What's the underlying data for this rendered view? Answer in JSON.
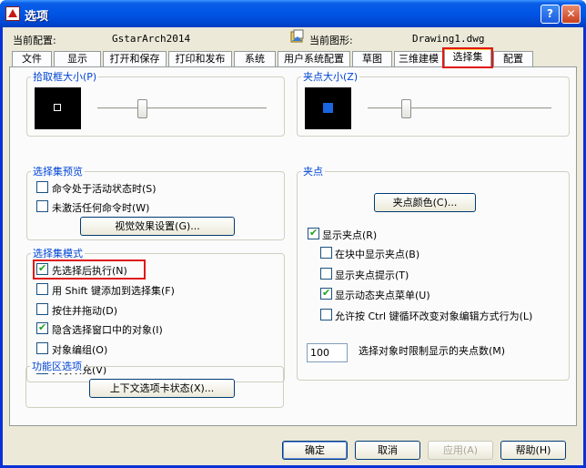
{
  "window": {
    "title": "选项"
  },
  "header": {
    "profile_label": "当前配置:",
    "profile_value": "GstarArch2014",
    "drawing_label": "当前图形:",
    "drawing_value": "Drawing1.dwg"
  },
  "tabs": [
    "文件",
    "显示",
    "打开和保存",
    "打印和发布",
    "系统",
    "用户系统配置",
    "草图",
    "三维建模",
    "选择集",
    "配置"
  ],
  "active_tab": "选择集",
  "pickbox": {
    "title": "拾取框大小(P)",
    "slider_level": 0.5
  },
  "grip_size": {
    "title": "夹点大小(Z)",
    "slider_level": 0.35
  },
  "selection_preview": {
    "title": "选择集预览",
    "options": [
      {
        "label": "命令处于活动状态时(S)",
        "checked": false
      },
      {
        "label": "未激活任何命令时(W)",
        "checked": false
      }
    ],
    "button": "视觉效果设置(G)..."
  },
  "selection_modes": {
    "title": "选择集模式",
    "options": [
      {
        "label": "先选择后执行(N)",
        "checked": true
      },
      {
        "label": "用 Shift 键添加到选择集(F)",
        "checked": false
      },
      {
        "label": "按住并拖动(D)",
        "checked": false
      },
      {
        "label": "隐含选择窗口中的对象(I)",
        "checked": true
      },
      {
        "label": "对象编组(O)",
        "checked": false
      },
      {
        "label": "关联填充(V)",
        "checked": false
      }
    ]
  },
  "ribbon": {
    "title": "功能区选项",
    "button": "上下文选项卡状态(X)..."
  },
  "grips": {
    "title": "夹点",
    "color_button": "夹点颜色(C)...",
    "options": [
      {
        "label": "显示夹点(R)",
        "checked": true
      },
      {
        "label": "在块中显示夹点(B)",
        "checked": false
      },
      {
        "label": "显示夹点提示(T)",
        "checked": false
      },
      {
        "label": "显示动态夹点菜单(U)",
        "checked": true
      },
      {
        "label": "允许按 Ctrl 键循环改变对象编辑方式行为(L)",
        "checked": false
      }
    ],
    "limit_value": "100",
    "limit_label": "选择对象时限制显示的夹点数(M)"
  },
  "footer": {
    "ok": "确定",
    "cancel": "取消",
    "apply": "应用(A)",
    "help": "帮助(H)"
  },
  "colors": {
    "title_bar": "#0055e5",
    "highlight": "#e01818",
    "group_title": "#0046d5",
    "grip_marker": "#1a66e0"
  }
}
